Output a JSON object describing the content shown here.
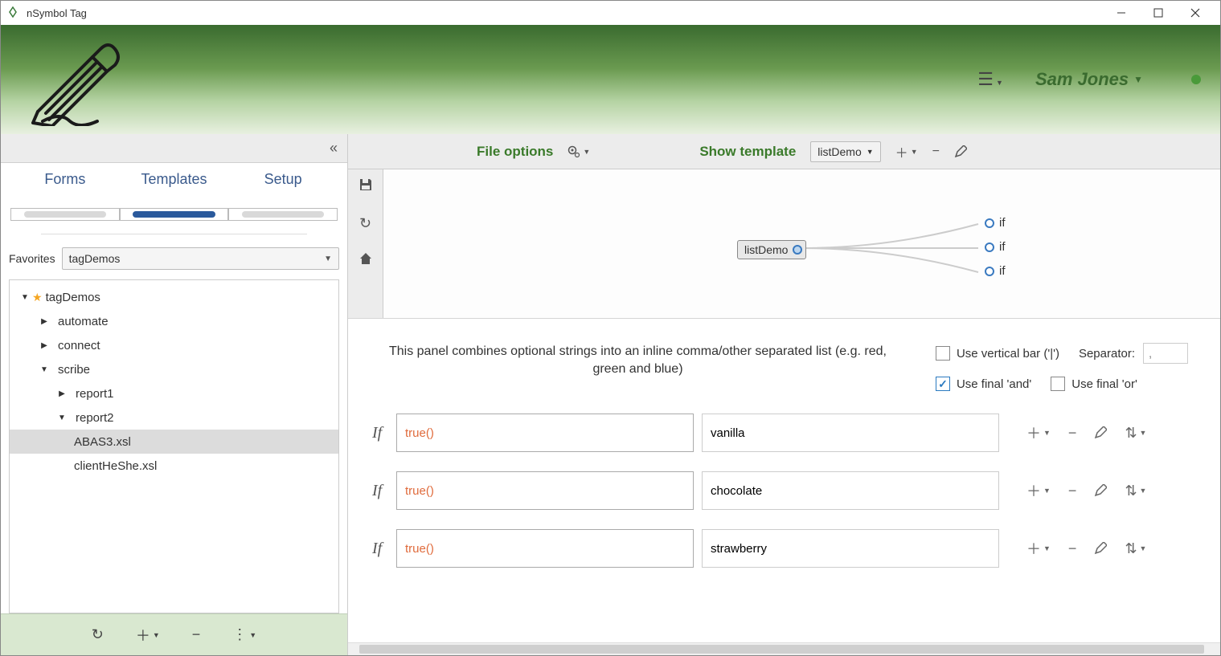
{
  "window": {
    "title": "nSymbol Tag"
  },
  "header": {
    "username": "Sam Jones"
  },
  "sidebar": {
    "tabs": {
      "forms": "Forms",
      "templates": "Templates",
      "setup": "Setup"
    },
    "favorites_label": "Favorites",
    "favorites_value": "tagDemos",
    "tree": {
      "root": "tagDemos",
      "items": {
        "automate": "automate",
        "connect": "connect",
        "scribe": "scribe",
        "report1": "report1",
        "report2": "report2",
        "abas3": "ABAS3.xsl",
        "client": "clientHeShe.xsl"
      }
    }
  },
  "toolbar": {
    "file_options": "File options",
    "show_template": "Show template",
    "template_select": "listDemo"
  },
  "graph": {
    "root_label": "listDemo",
    "child_label": "if"
  },
  "panel": {
    "description": "This panel combines optional strings into an inline comma/other separated list (e.g. red, green and blue)",
    "use_vertical_bar": "Use vertical bar ('|')",
    "separator_label": "Separator:",
    "separator_value": ",",
    "use_final_and": "Use final 'and'",
    "use_final_or": "Use final 'or'",
    "rows": [
      {
        "cond": "true()",
        "value": "vanilla"
      },
      {
        "cond": "true()",
        "value": "chocolate"
      },
      {
        "cond": "true()",
        "value": "strawberry"
      }
    ],
    "if_label": "If"
  }
}
